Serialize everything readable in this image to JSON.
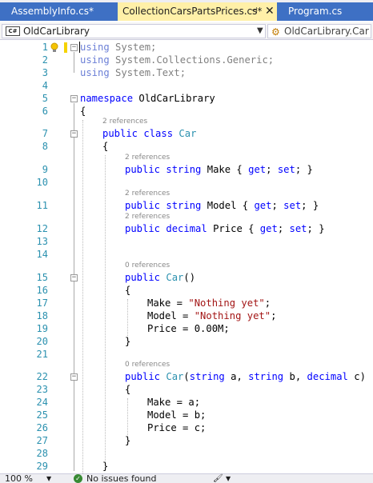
{
  "tabs": [
    {
      "label": "AssemblyInfo.cs*"
    },
    {
      "label": "CollectionCarsPartsPrices.cs*",
      "pin": "⊣",
      "close": "✕"
    },
    {
      "label": "Program.cs"
    }
  ],
  "nav": {
    "project_badge": "C#",
    "project": "OldCarLibrary",
    "member": "OldCarLibrary.Car"
  },
  "status": {
    "zoom": "100 %",
    "issues": "No issues found"
  },
  "colors": {
    "keyword": "#0000ff",
    "type": "#2b91af",
    "string": "#a31515",
    "line_number": "#2b91af",
    "tab_active_bg": "#fff0a8",
    "tab_bg": "#3e70c4"
  },
  "editor": {
    "line_numbers": [
      "1",
      "2",
      "3",
      "4",
      "5",
      "6",
      "7",
      "8",
      "9",
      "10",
      "11",
      "12",
      "13",
      "14",
      "15",
      "16",
      "17",
      "18",
      "19",
      "20",
      "21",
      "22",
      "23",
      "24",
      "25",
      "26",
      "27",
      "28",
      "29"
    ],
    "refs": {
      "class_car": "2 references",
      "make": "2 references",
      "model": "2 references",
      "price": "2 references",
      "ctor1": "0 references",
      "ctor2": "0 references"
    },
    "code": {
      "l1_kw": "using",
      "l1_rest": " System;",
      "l2_kw": "using",
      "l2_rest": " System.Collections.Generic;",
      "l3_kw": "using",
      "l3_rest": " System.Text;",
      "l5_kw": "namespace",
      "l5_rest": " OldCarLibrary",
      "l6": "{",
      "l7_kw1": "public",
      "l7_kw2": "class",
      "l7_ty": "Car",
      "l8": "{",
      "l9_kw1": "public",
      "l9_kw2": "string",
      "l9_name": "Make { ",
      "l9_get": "get",
      "l9_mid": "; ",
      "l9_set": "set",
      "l9_end": "; }",
      "l11_kw1": "public",
      "l11_kw2": "string",
      "l11_name": "Model { ",
      "l11_get": "get",
      "l11_mid": "; ",
      "l11_set": "set",
      "l11_end": "; }",
      "l12_kw1": "public",
      "l12_kw2": "decimal",
      "l12_name": "Price { ",
      "l12_get": "get",
      "l12_mid": "; ",
      "l12_set": "set",
      "l12_end": "; }",
      "l15_kw": "public",
      "l15_ty": "Car",
      "l15_rest": "()",
      "l16": "{",
      "l17_a": "Make = ",
      "l17_s": "\"Nothing yet\"",
      "l17_e": ";",
      "l18_a": "Model = ",
      "l18_s": "\"Nothing yet\"",
      "l18_e": ";",
      "l19": "Price = 0.00M;",
      "l20": "}",
      "l22_kw": "public",
      "l22_ty": "Car",
      "l22_p1": "(",
      "l22_k1": "string",
      "l22_a": " a, ",
      "l22_k2": "string",
      "l22_b": " b, ",
      "l22_k3": "decimal",
      "l22_c": " c)",
      "l23": "{",
      "l24": "Make = a;",
      "l25": "Model = b;",
      "l26": "Price = c;",
      "l27": "}",
      "l29": "}"
    }
  }
}
